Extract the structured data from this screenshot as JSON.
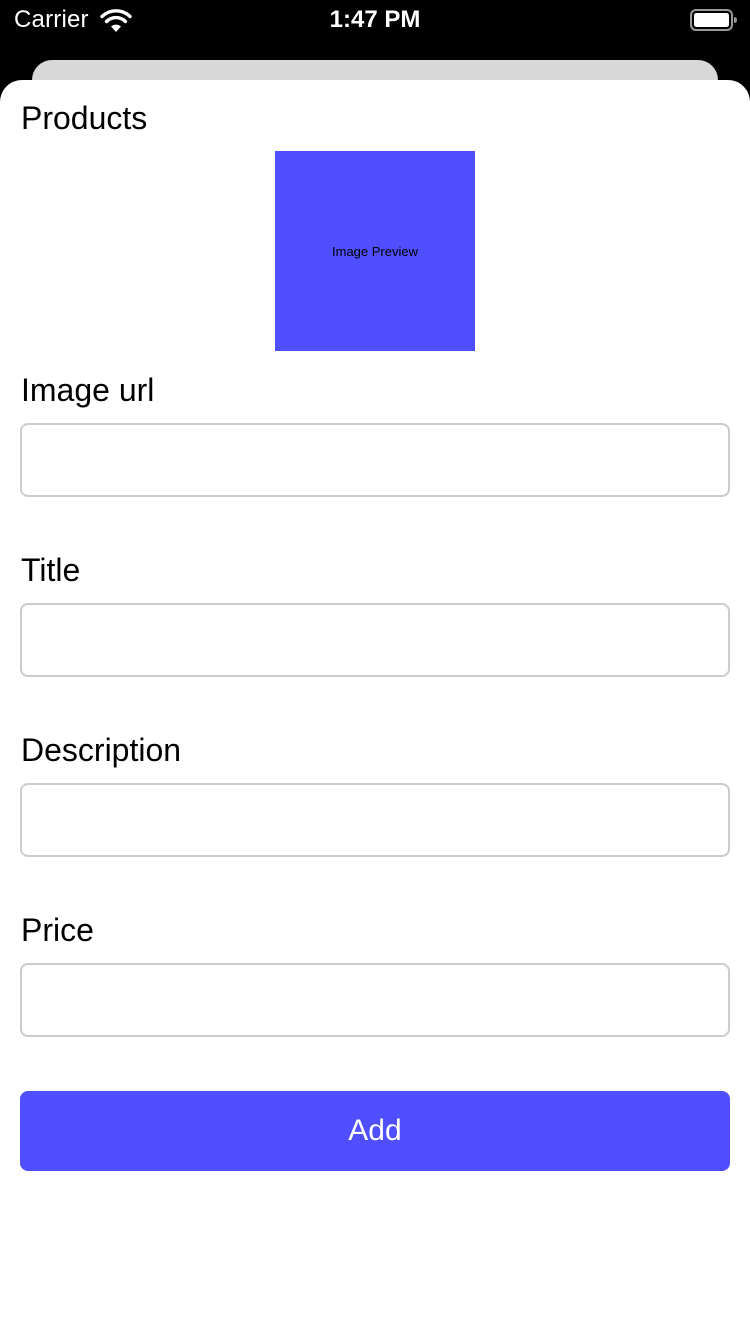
{
  "status_bar": {
    "carrier": "Carrier",
    "time": "1:47 PM",
    "wifi_icon": "wifi-icon",
    "battery_icon": "battery-icon"
  },
  "page": {
    "title": "Products",
    "preview_label": "Image Preview",
    "accent_color": "#4f4fff"
  },
  "form": {
    "fields": [
      {
        "label": "Image url",
        "value": "",
        "placeholder": ""
      },
      {
        "label": "Title",
        "value": "",
        "placeholder": ""
      },
      {
        "label": "Description",
        "value": "",
        "placeholder": ""
      },
      {
        "label": "Price",
        "value": "",
        "placeholder": ""
      }
    ],
    "submit_label": "Add"
  }
}
